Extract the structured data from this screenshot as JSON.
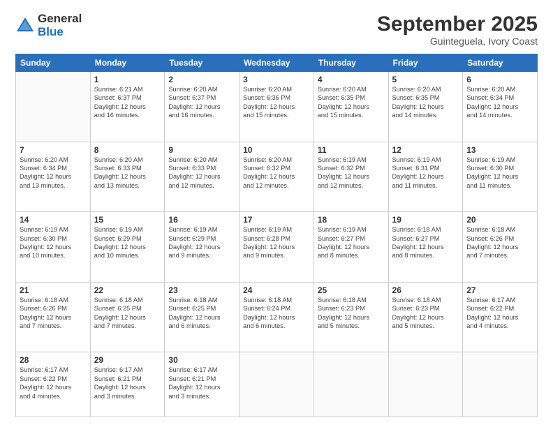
{
  "header": {
    "logo_general": "General",
    "logo_blue": "Blue",
    "title": "September 2025",
    "subtitle": "Guinteguela, Ivory Coast"
  },
  "columns": [
    "Sunday",
    "Monday",
    "Tuesday",
    "Wednesday",
    "Thursday",
    "Friday",
    "Saturday"
  ],
  "weeks": [
    [
      {
        "num": "",
        "info": ""
      },
      {
        "num": "1",
        "info": "Sunrise: 6:21 AM\nSunset: 6:37 PM\nDaylight: 12 hours\nand 16 minutes."
      },
      {
        "num": "2",
        "info": "Sunrise: 6:20 AM\nSunset: 6:37 PM\nDaylight: 12 hours\nand 16 minutes."
      },
      {
        "num": "3",
        "info": "Sunrise: 6:20 AM\nSunset: 6:36 PM\nDaylight: 12 hours\nand 15 minutes."
      },
      {
        "num": "4",
        "info": "Sunrise: 6:20 AM\nSunset: 6:35 PM\nDaylight: 12 hours\nand 15 minutes."
      },
      {
        "num": "5",
        "info": "Sunrise: 6:20 AM\nSunset: 6:35 PM\nDaylight: 12 hours\nand 14 minutes."
      },
      {
        "num": "6",
        "info": "Sunrise: 6:20 AM\nSunset: 6:34 PM\nDaylight: 12 hours\nand 14 minutes."
      }
    ],
    [
      {
        "num": "7",
        "info": "Sunrise: 6:20 AM\nSunset: 6:34 PM\nDaylight: 12 hours\nand 13 minutes."
      },
      {
        "num": "8",
        "info": "Sunrise: 6:20 AM\nSunset: 6:33 PM\nDaylight: 12 hours\nand 13 minutes."
      },
      {
        "num": "9",
        "info": "Sunrise: 6:20 AM\nSunset: 6:33 PM\nDaylight: 12 hours\nand 12 minutes."
      },
      {
        "num": "10",
        "info": "Sunrise: 6:20 AM\nSunset: 6:32 PM\nDaylight: 12 hours\nand 12 minutes."
      },
      {
        "num": "11",
        "info": "Sunrise: 6:19 AM\nSunset: 6:32 PM\nDaylight: 12 hours\nand 12 minutes."
      },
      {
        "num": "12",
        "info": "Sunrise: 6:19 AM\nSunset: 6:31 PM\nDaylight: 12 hours\nand 11 minutes."
      },
      {
        "num": "13",
        "info": "Sunrise: 6:19 AM\nSunset: 6:30 PM\nDaylight: 12 hours\nand 11 minutes."
      }
    ],
    [
      {
        "num": "14",
        "info": "Sunrise: 6:19 AM\nSunset: 6:30 PM\nDaylight: 12 hours\nand 10 minutes."
      },
      {
        "num": "15",
        "info": "Sunrise: 6:19 AM\nSunset: 6:29 PM\nDaylight: 12 hours\nand 10 minutes."
      },
      {
        "num": "16",
        "info": "Sunrise: 6:19 AM\nSunset: 6:29 PM\nDaylight: 12 hours\nand 9 minutes."
      },
      {
        "num": "17",
        "info": "Sunrise: 6:19 AM\nSunset: 6:28 PM\nDaylight: 12 hours\nand 9 minutes."
      },
      {
        "num": "18",
        "info": "Sunrise: 6:19 AM\nSunset: 6:27 PM\nDaylight: 12 hours\nand 8 minutes."
      },
      {
        "num": "19",
        "info": "Sunrise: 6:18 AM\nSunset: 6:27 PM\nDaylight: 12 hours\nand 8 minutes."
      },
      {
        "num": "20",
        "info": "Sunrise: 6:18 AM\nSunset: 6:26 PM\nDaylight: 12 hours\nand 7 minutes."
      }
    ],
    [
      {
        "num": "21",
        "info": "Sunrise: 6:18 AM\nSunset: 6:26 PM\nDaylight: 12 hours\nand 7 minutes."
      },
      {
        "num": "22",
        "info": "Sunrise: 6:18 AM\nSunset: 6:25 PM\nDaylight: 12 hours\nand 7 minutes."
      },
      {
        "num": "23",
        "info": "Sunrise: 6:18 AM\nSunset: 6:25 PM\nDaylight: 12 hours\nand 6 minutes."
      },
      {
        "num": "24",
        "info": "Sunrise: 6:18 AM\nSunset: 6:24 PM\nDaylight: 12 hours\nand 6 minutes."
      },
      {
        "num": "25",
        "info": "Sunrise: 6:18 AM\nSunset: 6:23 PM\nDaylight: 12 hours\nand 5 minutes."
      },
      {
        "num": "26",
        "info": "Sunrise: 6:18 AM\nSunset: 6:23 PM\nDaylight: 12 hours\nand 5 minutes."
      },
      {
        "num": "27",
        "info": "Sunrise: 6:17 AM\nSunset: 6:22 PM\nDaylight: 12 hours\nand 4 minutes."
      }
    ],
    [
      {
        "num": "28",
        "info": "Sunrise: 6:17 AM\nSunset: 6:22 PM\nDaylight: 12 hours\nand 4 minutes."
      },
      {
        "num": "29",
        "info": "Sunrise: 6:17 AM\nSunset: 6:21 PM\nDaylight: 12 hours\nand 3 minutes."
      },
      {
        "num": "30",
        "info": "Sunrise: 6:17 AM\nSunset: 6:21 PM\nDaylight: 12 hours\nand 3 minutes."
      },
      {
        "num": "",
        "info": ""
      },
      {
        "num": "",
        "info": ""
      },
      {
        "num": "",
        "info": ""
      },
      {
        "num": "",
        "info": ""
      }
    ]
  ]
}
